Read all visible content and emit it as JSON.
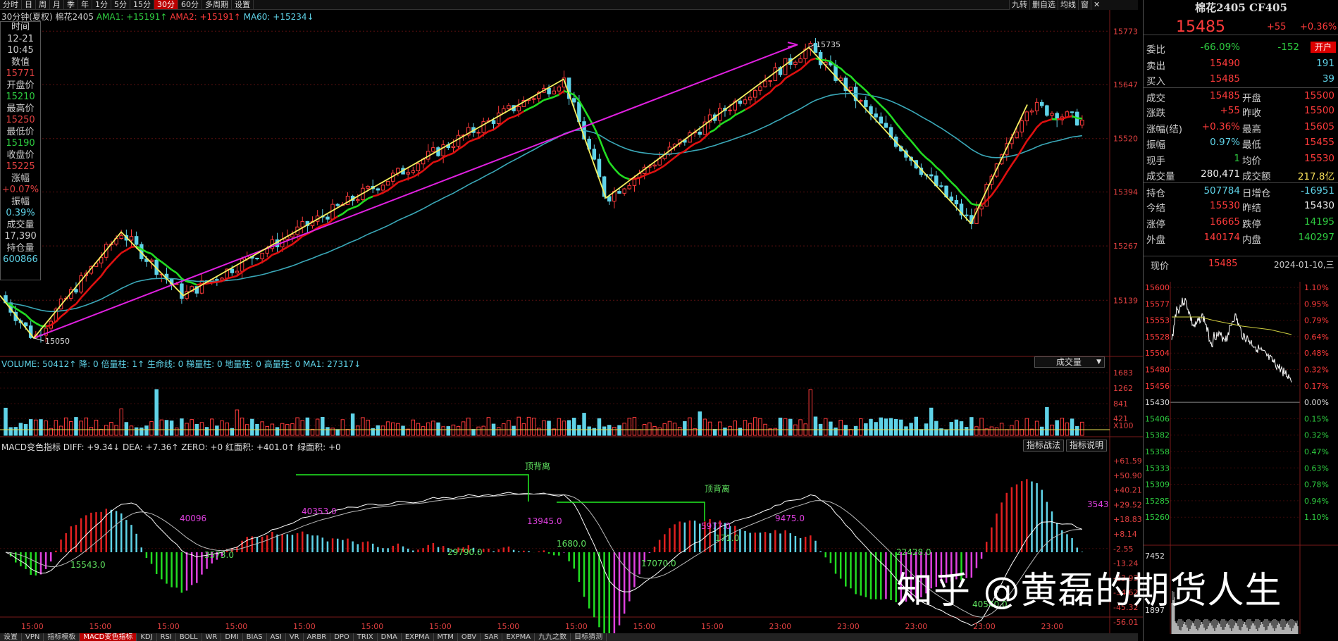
{
  "toolbar": {
    "items": [
      "分时",
      "日",
      "周",
      "月",
      "季",
      "年",
      "1分",
      "5分",
      "15分",
      "30分",
      "60分",
      "多周期",
      "设置"
    ],
    "active": "30分",
    "right_items": [
      "九转",
      "删自选",
      "均线",
      "窗",
      "✕"
    ]
  },
  "main_legend": {
    "period": "30分钟(夏权)",
    "symbol": "棉花2405",
    "ama1": "AMA1: +15191↑",
    "ama2": "AMA2: +15191↑",
    "ma60": "MA60: +15234↓"
  },
  "info_box": {
    "rows": [
      {
        "label": "时间",
        "value": "12-21",
        "color": "neutral"
      },
      {
        "label": "",
        "value": "10:45",
        "color": "neutral"
      },
      {
        "label": "数值",
        "value": "15771",
        "color": "red"
      },
      {
        "label": "开盘价",
        "value": "15210",
        "color": "green"
      },
      {
        "label": "最高价",
        "value": "15250",
        "color": "red"
      },
      {
        "label": "最低价",
        "value": "15190",
        "color": "green"
      },
      {
        "label": "收盘价",
        "value": "15225",
        "color": "red"
      },
      {
        "label": "涨幅",
        "value": "+0.07%",
        "color": "red"
      },
      {
        "label": "振幅",
        "value": "0.39%",
        "color": "cyan"
      },
      {
        "label": "成交量",
        "value": "17,390",
        "color": "neutral"
      },
      {
        "label": "持仓量",
        "value": "600866",
        "color": "cyan"
      }
    ]
  },
  "price_axis": [
    "15773",
    "15647",
    "15520",
    "15394",
    "15267",
    "15139"
  ],
  "volume_axis": [
    "1683",
    "1262",
    "841",
    "421",
    "X100"
  ],
  "macd_axis": [
    "+61.59",
    "+50.90",
    "+40.21",
    "+29.52",
    "+18.83",
    "+8.14",
    "-2.55",
    "-13.24",
    "-23.93",
    "-34.62",
    "-45.32",
    "-56.01"
  ],
  "time_axis": [
    "15:00",
    "15:00",
    "15:00",
    "15:00",
    "15:00",
    "15:00",
    "15:00",
    "15:00",
    "15:00",
    "15:00",
    "15:00",
    "23:00",
    "23:00",
    "23:00",
    "23:00",
    "23:00"
  ],
  "volume_legend": {
    "text": "VOLUME: 50412↑ 降: 0 倍量柱: 1↑ 生命线: 0 梯量柱: 0 地量柱: 0 高量柱: 0 MA1: 27317↓",
    "select": "成交量"
  },
  "macd_legend": {
    "text": "MACD变色指标 DIFF: +9.34↓ DEA: +7.36↑ ZERO: +0 红面积: +401.0↑ 绿面积: +0",
    "btn1": "指标战法",
    "btn2": "指标说明"
  },
  "annotations": {
    "high": "15735",
    "low": "15050",
    "divergence1": "顶背离",
    "divergence2": "顶背离",
    "macd_areas": [
      "15543.0",
      "40096",
      "3573.0",
      "40353.0",
      "29790.0",
      "13945.0",
      "1680.0",
      "17070.0",
      "5977.0",
      "171.0",
      "9475.0",
      "22428.0",
      "40540.0",
      "3543"
    ]
  },
  "bottom_tabs": [
    "设置",
    "VPN",
    "指标模板",
    "MACD变色指标",
    "KDJ",
    "RSI",
    "BOLL",
    "WR",
    "DMI",
    "BIAS",
    "ASI",
    "VR",
    "ARBR",
    "DPO",
    "TRIX",
    "DMA",
    "EXPMA",
    "MTM",
    "OBV",
    "SAR",
    "EXPMA",
    "九九之数",
    "目标猜测"
  ],
  "bottom_active": "MACD变色指标",
  "right_panel": {
    "title": "棉花2405 CF405",
    "price": "15485",
    "change": "+55",
    "change_pct": "+0.36%",
    "rows": [
      {
        "l1": "委比",
        "v1": "-66.09%",
        "c1": "green",
        "l2": "",
        "v2": "-152",
        "c2": "green",
        "extra": "开户"
      },
      {
        "l1": "卖出",
        "v1": "15490",
        "c1": "red",
        "l2": "",
        "v2": "191",
        "c2": "cyan"
      },
      {
        "l1": "买入",
        "v1": "15485",
        "c1": "red",
        "l2": "",
        "v2": "39",
        "c2": "cyan"
      },
      {
        "l1": "成交",
        "v1": "15485",
        "c1": "red",
        "l2": "开盘",
        "v2": "15500",
        "c2": "red"
      },
      {
        "l1": "涨跌",
        "v1": "+55",
        "c1": "red",
        "l2": "昨收",
        "v2": "15500",
        "c2": "red"
      },
      {
        "l1": "涨幅(结)",
        "v1": "+0.36%",
        "c1": "red",
        "l2": "最高",
        "v2": "15605",
        "c2": "red"
      },
      {
        "l1": "振幅",
        "v1": "0.97%",
        "c1": "cyan",
        "l2": "最低",
        "v2": "15455",
        "c2": "red"
      },
      {
        "l1": "现手",
        "v1": "1",
        "c1": "green",
        "l2": "均价",
        "v2": "15530",
        "c2": "red"
      },
      {
        "l1": "成交量",
        "v1": "280,471",
        "c1": "white",
        "l2": "成交额",
        "v2": "217.8亿",
        "c2": "yellow"
      },
      {
        "l1": "持仓",
        "v1": "507784",
        "c1": "cyan",
        "l2": "日增仓",
        "v2": "-16951",
        "c2": "cyan"
      },
      {
        "l1": "今结",
        "v1": "15530",
        "c1": "red",
        "l2": "昨结",
        "v2": "15430",
        "c2": "white"
      },
      {
        "l1": "涨停",
        "v1": "16665",
        "c1": "red",
        "l2": "跌停",
        "v2": "14195",
        "c2": "green"
      },
      {
        "l1": "外盘",
        "v1": "140174",
        "c1": "red",
        "l2": "内盘",
        "v2": "140297",
        "c2": "green"
      }
    ],
    "mini_header": {
      "label": "现价",
      "price": "15485",
      "date": "2024-01-10,三"
    },
    "mini_left_axis": [
      "15600",
      "15577",
      "15553",
      "15528",
      "15504",
      "15480",
      "15456",
      "15430",
      "15406",
      "15382",
      "15358",
      "15333",
      "15309",
      "15285",
      "15260",
      "7452",
      "1897"
    ],
    "mini_right_axis": [
      "1.10%",
      "0.95%",
      "0.79%",
      "0.64%",
      "0.48%",
      "0.32%",
      "0.17%",
      "0.00%",
      "0.15%",
      "0.32%",
      "0.47%",
      "0.63%",
      "0.78%",
      "0.94%",
      "1.10%"
    ]
  },
  "watermark": "知乎 @黄磊的期货人生",
  "colors": {
    "up": "#ff3b3b",
    "down": "#5fd3e8",
    "ama_red": "#e01010",
    "ama_green": "#22dd22",
    "ma60": "#3aa8b8",
    "zigzag": "#f5f060",
    "trendline": "#e020e0"
  },
  "chart_data": {
    "type": "candlestick",
    "title": "棉花2405",
    "price_range": [
      15010,
      15800
    ],
    "high_marker": 15735,
    "low_marker": 15050,
    "zigzag_prices": [
      15150,
      15050,
      15300,
      15150,
      15660,
      15380,
      15735,
      15320,
      15600
    ]
  }
}
